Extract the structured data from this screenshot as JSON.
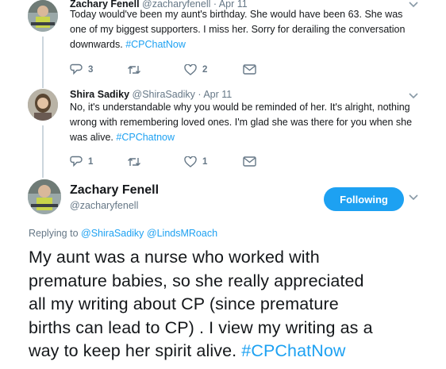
{
  "tweets": [
    {
      "author_name": "Zachary Fenell",
      "handle_date": "@zacharyfenell · Apr 11",
      "text_parts": [
        "Today would've been my aunt's birthday. She would have been 63. She was",
        "one of my biggest supporters. I miss her. Sorry for derailing the conversation",
        "downwards."
      ],
      "hashtag": "#CPChatNow",
      "reply_count": "3",
      "retweet_count": "",
      "like_count": "2"
    },
    {
      "author_name": "Shira Sadiky",
      "handle_date": "@ShiraSadiky · Apr 11",
      "text_parts": [
        "No, it's understandable why you would be reminded of her. It's alright, nothing",
        "wrong with remembering loved ones. I'm glad she was there for you when she",
        "was alive."
      ],
      "hashtag": "#CPChatnow",
      "reply_count": "1",
      "retweet_count": "",
      "like_count": "1"
    }
  ],
  "main_tweet": {
    "author_name": "Zachary Fenell",
    "handle": "@zacharyfenell",
    "follow_label": "Following",
    "replying_prefix": "Replying to",
    "replying_to": [
      "@ShiraSadiky",
      "@LindsMRoach"
    ],
    "text_lines": [
      "My aunt was a nurse who worked with",
      "premature babies, so she really appreciated",
      "all my writing about CP (since premature",
      "births can lead to CP) . I view my writing as a",
      "way to keep her spirit alive."
    ],
    "hashtag": "#CPChatNow"
  },
  "colors": {
    "accent": "#1da1f2",
    "meta_text": "#657786",
    "thread_line": "#ccd6dd"
  },
  "icons": [
    "reply-icon",
    "retweet-icon",
    "like-icon",
    "message-icon",
    "chevron-down-icon"
  ]
}
